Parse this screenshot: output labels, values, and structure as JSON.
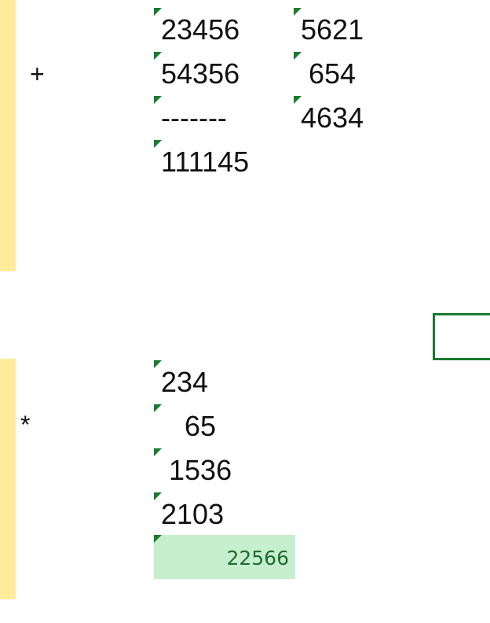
{
  "addition": {
    "operator": "+",
    "col_a": [
      "23456",
      "54356",
      "-------",
      "111145"
    ],
    "col_b": [
      "5621",
      " 654",
      "4634"
    ]
  },
  "multiplication": {
    "operator": "*",
    "rows": [
      "234",
      "   65",
      " 1536",
      "2103"
    ],
    "result": "22566"
  },
  "colors": {
    "band": "#ffeb9c",
    "marker": "#1a7a2e",
    "result_fill": "#c6efce",
    "result_text": "#1f6b31"
  }
}
